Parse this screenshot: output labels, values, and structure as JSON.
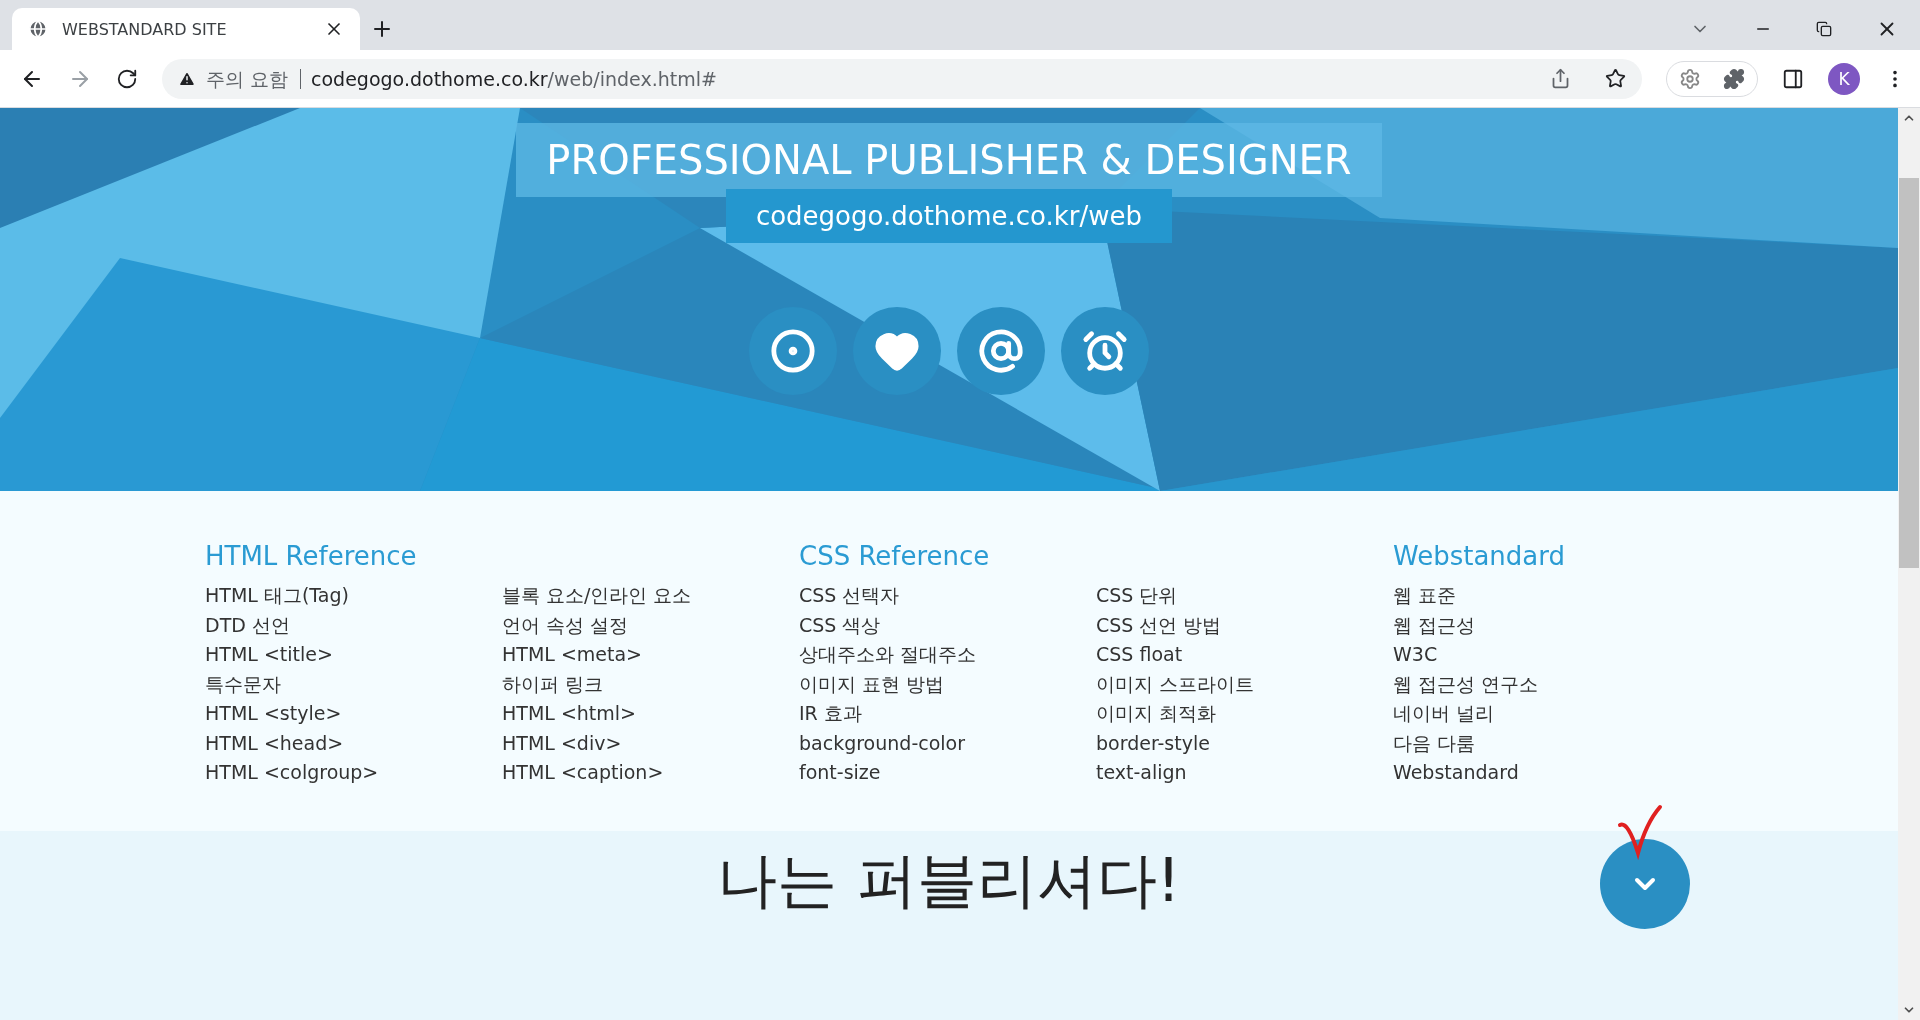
{
  "browser": {
    "tab": {
      "title": "WEBSTANDARD SITE",
      "selected": true
    },
    "address": {
      "warning": "주의 요함",
      "host": "codegogo.dothome.co.kr",
      "path": "/web/index.html#"
    },
    "profile": "K"
  },
  "hero": {
    "title": "PROFESSIONAL PUBLISHER & DESIGNER",
    "subtitle": "codegogo.dothome.co.kr/web",
    "icons": [
      {
        "kind": "target"
      },
      {
        "kind": "heart"
      },
      {
        "kind": "at"
      },
      {
        "kind": "alarm"
      }
    ]
  },
  "references": [
    {
      "heading": "HTML Reference",
      "columns": [
        [
          "HTML 태그(Tag)",
          "DTD 선언",
          "HTML <title>",
          "특수문자",
          "HTML <style>",
          "HTML <head>",
          "HTML <colgroup>"
        ],
        [
          "블록 요소/인라인 요소",
          "언어 속성 설정",
          "HTML <meta>",
          "하이퍼 링크",
          "HTML <html>",
          "HTML <div>",
          "HTML <caption>"
        ]
      ]
    },
    {
      "heading": "CSS Reference",
      "columns": [
        [
          "CSS 선택자",
          "CSS 색상",
          "상대주소와 절대주소",
          "이미지 표현 방법",
          "IR 효과",
          "background-color",
          "font-size"
        ],
        [
          "CSS 단위",
          "CSS 선언 방법",
          "CSS float",
          "이미지 스프라이트",
          "이미지 최적화",
          "border-style",
          "text-align"
        ]
      ]
    },
    {
      "heading": "Webstandard",
      "columns": [
        [
          "웹 표준",
          "웹 접근성",
          "W3C",
          "웹 접근성 연구소",
          "네이버 널리",
          "다음 다룸",
          "Webstandard"
        ]
      ]
    }
  ],
  "banner": {
    "heading": "나는 퍼블리셔다!"
  }
}
